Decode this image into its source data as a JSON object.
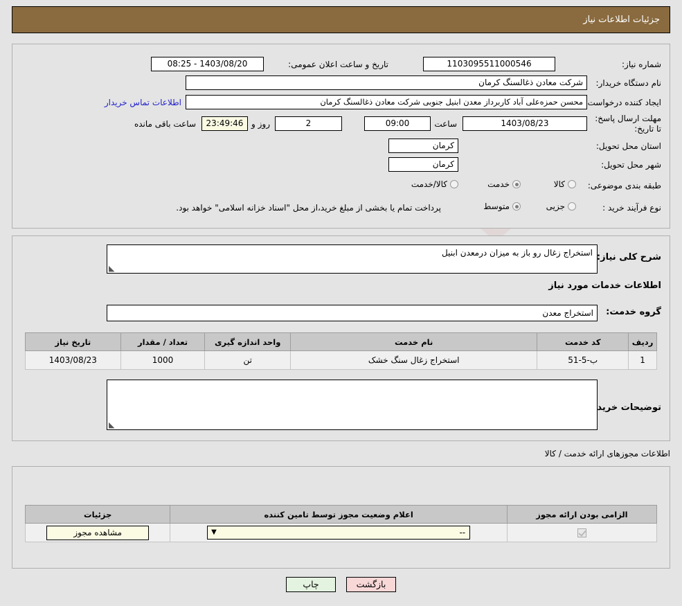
{
  "header": {
    "title": "جزئیات اطلاعات نیاز",
    "bar_color": "#8a6b3f"
  },
  "watermark": {
    "text": "AriaTender.net"
  },
  "main": {
    "need_number_label": "شماره نیاز:",
    "need_number_value": "1103095511000546",
    "public_announce_label": "تاریخ و ساعت اعلان عمومی:",
    "public_announce_value": "1403/08/20 - 08:25",
    "buyer_org_label": "نام دستگاه خریدار:",
    "buyer_org_value": "شرکت معادن ذغالسنگ کرمان",
    "creator_label": "ایجاد کننده درخواست:",
    "creator_value": "محسن حمزه‌علی آباد کاربرداز معدن ابنیل جنوبی شرکت معادن ذغالسنگ کرمان",
    "contact_link": "اطلاعات تماس خریدار",
    "deadline_label": "مهلت ارسال پاسخ: تا تاریخ:",
    "deadline_date": "1403/08/23",
    "hour_label": "ساعت",
    "deadline_time": "09:00",
    "days_remaining": "2",
    "days_word": "روز و",
    "countdown": "23:49:46",
    "countdown_suffix": "ساعت باقی مانده",
    "province_label": "استان محل تحویل:",
    "province_value": "کرمان",
    "city_label": "شهر محل تحویل:",
    "city_value": "کرمان",
    "category_label": "طبقه بندی موضوعی:",
    "category_options": [
      {
        "label": "کالا",
        "checked": false
      },
      {
        "label": "خدمت",
        "checked": true
      },
      {
        "label": "کالا/خدمت",
        "checked": false
      }
    ],
    "process_label": "نوع فرآیند خرید :",
    "process_options": [
      {
        "label": "جزیی",
        "checked": false
      },
      {
        "label": "متوسط",
        "checked": true
      }
    ],
    "process_note": "پرداخت تمام یا بخشی از مبلغ خرید،از محل \"اسناد خزانه اسلامی\" خواهد بود."
  },
  "detail": {
    "general_desc_label": "شرح کلی نیاز:",
    "general_desc_value": "استخراج زغال رو باز   به میزان  درمعدن ابنیل",
    "services_heading": "اطلاعات خدمات مورد نیاز",
    "service_group_label": "گروه خدمت:",
    "service_group_value": "استخراج معدن",
    "table": {
      "columns": [
        "ردیف",
        "کد خدمت",
        "نام خدمت",
        "واحد اندازه گیری",
        "تعداد / مقدار",
        "تاریخ نیاز"
      ],
      "rows": [
        [
          "1",
          "ب-5-51",
          "استخراج زغال سنگ خشک",
          "تن",
          "1000",
          "1403/08/23"
        ]
      ]
    },
    "buyer_notes_label": "توضیحات خریدار:",
    "buyer_notes_value": ""
  },
  "permits": {
    "section_title": "اطلاعات مجوزهای ارائه خدمت / کالا",
    "table": {
      "columns": [
        "الزامی بودن ارائه مجوز",
        "اعلام وضعیت مجوز توسط تامین کننده",
        "جزئیات"
      ],
      "rows": [
        {
          "required_checked": true,
          "status_value": "--",
          "detail_button": "مشاهده مجوز"
        }
      ]
    }
  },
  "footer": {
    "back_label": "بازگشت",
    "print_label": "چاپ",
    "back_color": "#f8d7d7",
    "print_color": "#e4f3e0"
  }
}
